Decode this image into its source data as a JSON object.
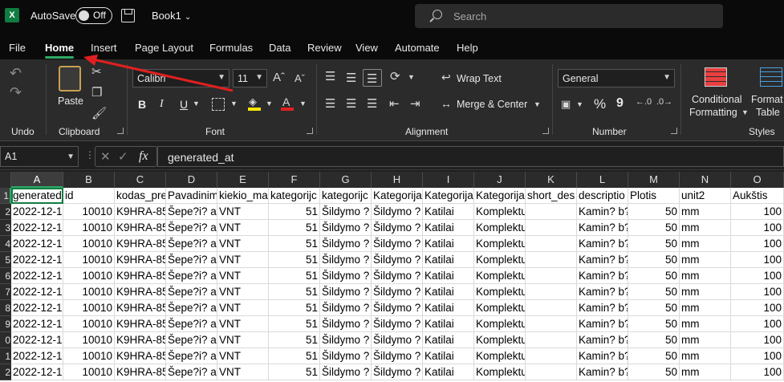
{
  "titlebar": {
    "app_icon": "X",
    "autosave_label": "AutoSave",
    "toggle_state": "Off",
    "book_title": "Book1",
    "search_placeholder": "Search"
  },
  "tabs": [
    "File",
    "Home",
    "Insert",
    "Page Layout",
    "Formulas",
    "Data",
    "Review",
    "View",
    "Automate",
    "Help"
  ],
  "active_tab": "Home",
  "ribbon": {
    "undo_group": "Undo",
    "clipboard_group": "Clipboard",
    "paste_label": "Paste",
    "font_group": "Font",
    "font_name": "Calibri",
    "font_size": "11",
    "bold": "B",
    "italic": "I",
    "underline": "U",
    "alignment_group": "Alignment",
    "wrap_text": "Wrap Text",
    "merge_center": "Merge & Center",
    "number_group": "Number",
    "number_format": "General",
    "percent": "%",
    "comma": "9",
    "styles_group": "Styles",
    "conditional_formatting_1": "Conditional",
    "conditional_formatting_2": "Formatting",
    "format_as_table_1": "Format",
    "format_as_table_2": "Table"
  },
  "formula_bar": {
    "name_box": "A1",
    "fx": "fx",
    "formula": "generated_at"
  },
  "columns": [
    "A",
    "B",
    "C",
    "D",
    "E",
    "F",
    "G",
    "H",
    "I",
    "J",
    "K",
    "L",
    "M",
    "N",
    "O"
  ],
  "row_numbers": [
    "1",
    "2",
    "3",
    "4",
    "5",
    "6",
    "7",
    "8",
    "9",
    "0",
    "1",
    "2"
  ],
  "header_row": [
    "generated_at",
    "id",
    "kodas_pre",
    "Pavadinim",
    "kiekio_ma",
    "kategorijc",
    "kategorijc",
    "Kategorija",
    "Kategorija",
    "Kategorija",
    "short_des",
    "descriptio",
    "Plotis",
    "unit2",
    "Aukštis"
  ],
  "data_row": [
    "2022-12-1",
    "10010",
    "K9HRA-85",
    "Šepe?i? ai",
    "VNT",
    "51",
    "Šildymo ?",
    "Šildymo ?",
    "Katilai",
    "Komplektuojan?ios i",
    "",
    "Kamin? b?",
    "50",
    "mm",
    "100"
  ],
  "data_row_count": 11,
  "colors": {
    "accent": "#2fa866",
    "excel_green": "#107c41",
    "arrow": "#e02020"
  }
}
